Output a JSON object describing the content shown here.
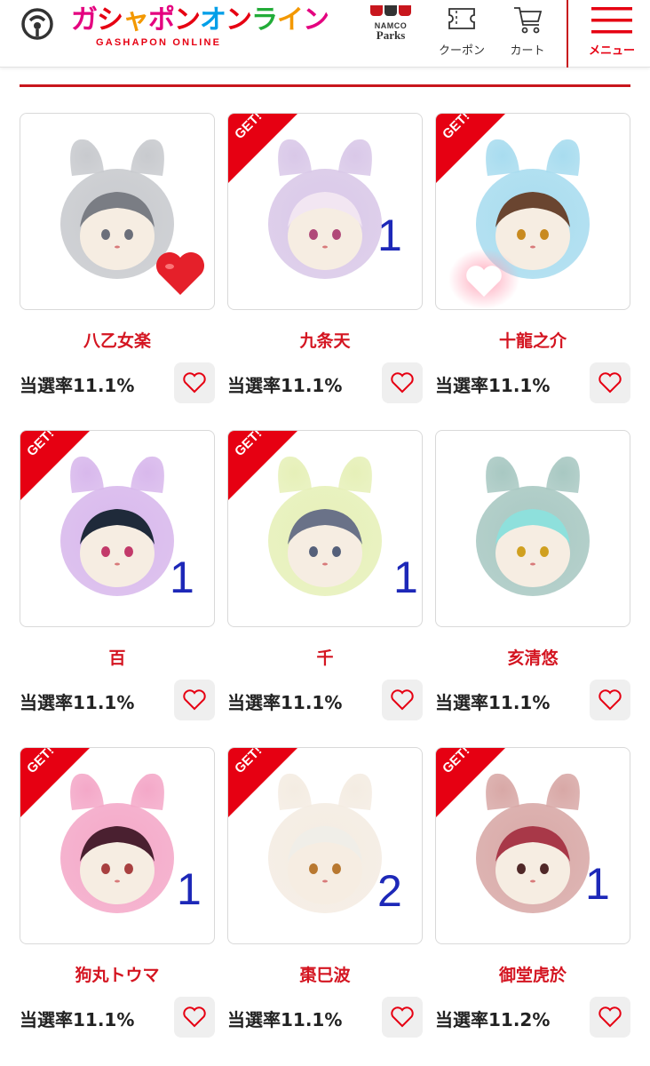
{
  "header": {
    "logo_text": [
      "ガ",
      "シ",
      "ャ",
      "ポ",
      "ン",
      "オ",
      "ン",
      "ラ",
      "イ",
      "ン"
    ],
    "logo_sub": "GASHAPON ONLINE",
    "namco_line1": "NAMCO",
    "namco_line2": "Parks",
    "coupon_label": "クーポン",
    "cart_label": "カート",
    "menu_label": "メニュー"
  },
  "get_label": "GET!",
  "items": [
    {
      "name": "八乙女楽",
      "rate": "当選率11.1%",
      "get": false,
      "count": "",
      "fur": "#c8cace",
      "hair": "#7a7d84",
      "eye": "#6b6f7a"
    },
    {
      "name": "九条天",
      "rate": "当選率11.1%",
      "get": true,
      "count": "1",
      "fur": "#d9c8e8",
      "hair": "#f2e6f2",
      "eye": "#b04878"
    },
    {
      "name": "十龍之介",
      "rate": "当選率11.1%",
      "get": true,
      "count": "",
      "fur": "#a8dcef",
      "hair": "#6a4530",
      "eye": "#c88a20"
    },
    {
      "name": "百",
      "rate": "当選率11.1%",
      "get": true,
      "count": "1",
      "fur": "#d8b8ec",
      "hair": "#1f2a3a",
      "eye": "#c23a6a"
    },
    {
      "name": "千",
      "rate": "当選率11.1%",
      "get": true,
      "count": "1",
      "fur": "#e6f0b8",
      "hair": "#6a7288",
      "eye": "#55607a"
    },
    {
      "name": "亥清悠",
      "rate": "当選率11.1%",
      "get": false,
      "count": "",
      "fur": "#a8c8c2",
      "hair": "#8ee0dc",
      "eye": "#d0a020"
    },
    {
      "name": "狗丸トウマ",
      "rate": "当選率11.1%",
      "get": true,
      "count": "1",
      "fur": "#f4a8c8",
      "hair": "#4a2030",
      "eye": "#a84040"
    },
    {
      "name": "棗巳波",
      "rate": "当選率11.1%",
      "get": true,
      "count": "2",
      "fur": "#f4ece2",
      "hair": "#f0eee8",
      "eye": "#b87830"
    },
    {
      "name": "御堂虎於",
      "rate": "当選率11.2%",
      "get": true,
      "count": "1",
      "fur": "#d8a8a6",
      "hair": "#a83848",
      "eye": "#502828"
    }
  ]
}
